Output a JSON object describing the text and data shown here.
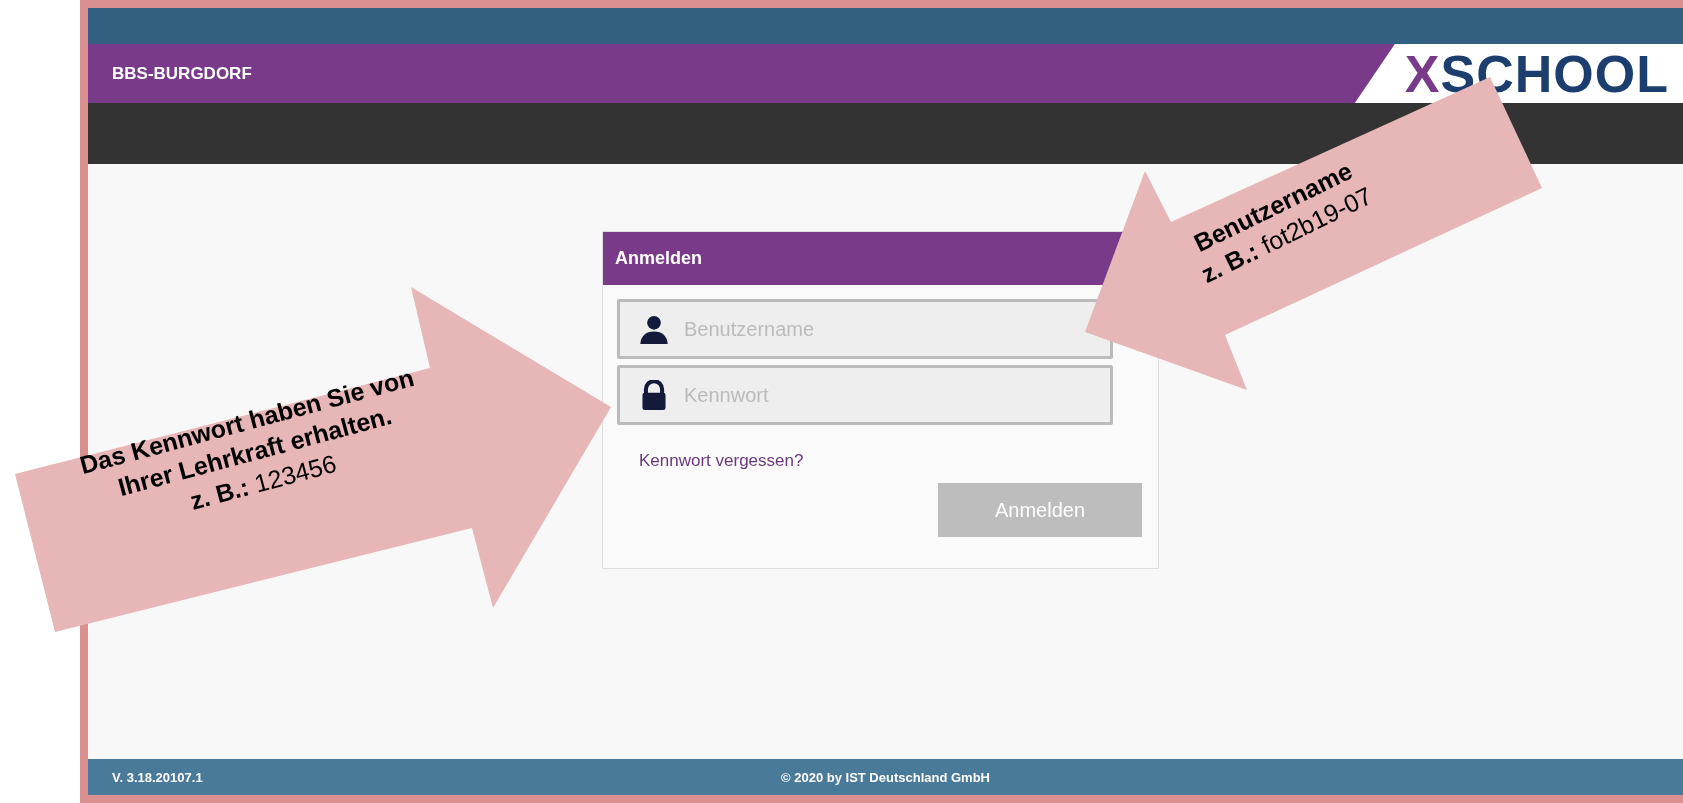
{
  "header": {
    "school": "BBS-BURGDORF",
    "logo": {
      "accent": "X",
      "rest": "SCHOOL"
    }
  },
  "login": {
    "title": "Anmelden",
    "fields": [
      {
        "kind": "user",
        "placeholder": "Benutzername"
      },
      {
        "kind": "password",
        "placeholder": "Kennwort"
      }
    ],
    "forgot_link": "Kennwort vergessen?",
    "submit": {
      "label": "Anmelden",
      "disabled": true
    }
  },
  "footer": {
    "version": "V. 3.18.20107.1",
    "copyright": "© 2020 by IST Deutschland GmbH"
  },
  "annotations": [
    {
      "kind": "arrow-right",
      "text": "Das Kennwort haben Sie von Ihrer Lehrkraft erhalten.",
      "example": "**z. B.:** 123456"
    },
    {
      "kind": "arrow-left",
      "text": "Benutzername",
      "example": "**z. B.:** fot2b19-07"
    }
  ]
}
